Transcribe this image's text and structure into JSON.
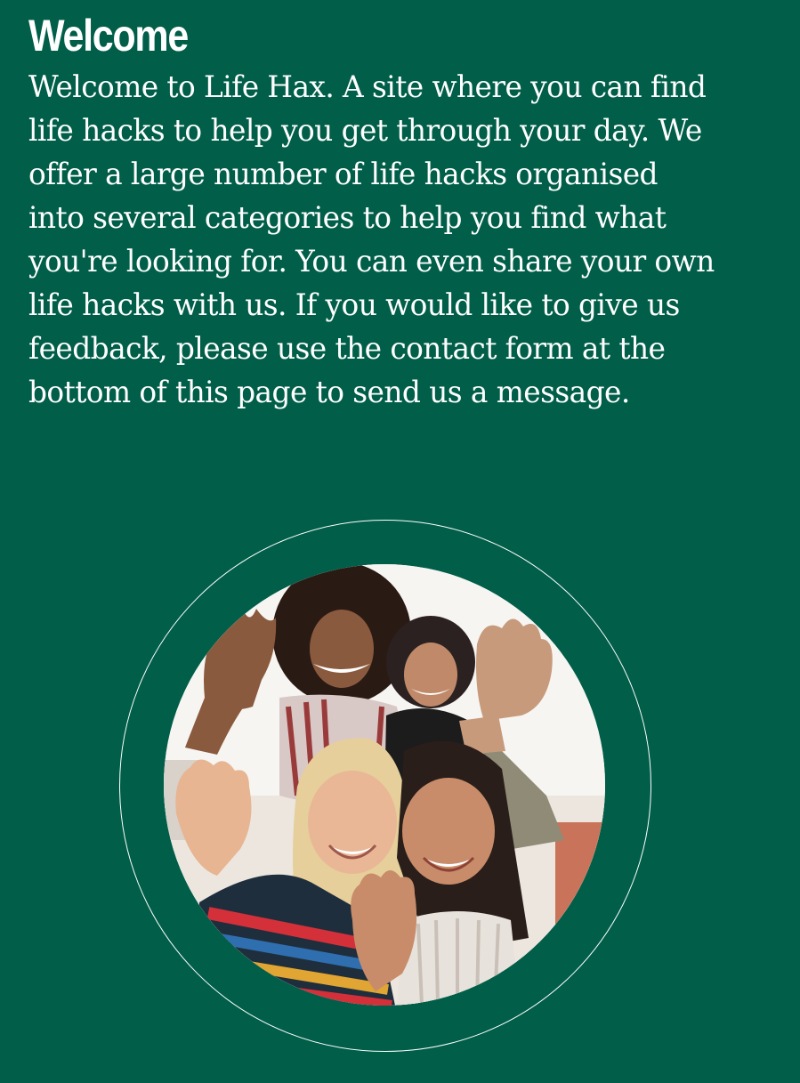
{
  "welcome": {
    "heading": "Welcome",
    "body": "Welcome to Life Hax. A site where you can find life hacks to help you get through your day. We offer a large number of life hacks organised into several categories to help you find what you're looking for. You can even share your own life hacks with us. If you would like to give us feedback, please use the contact form at the bottom of this page to send us a message."
  },
  "image": {
    "subject": "group-of-four-smiling-women-waving"
  },
  "colors": {
    "background": "#005e49",
    "text": "#ffffff",
    "ring": "#ffffff"
  }
}
